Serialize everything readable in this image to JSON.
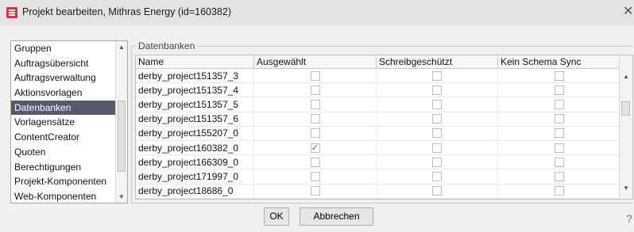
{
  "window": {
    "title": "Projekt bearbeiten, Mithras Energy (id=160382)",
    "close_glyph": "✕"
  },
  "sidebar": {
    "items": [
      {
        "label": "Gruppen"
      },
      {
        "label": "Auftragsübersicht"
      },
      {
        "label": "Auftragsverwaltung"
      },
      {
        "label": "Aktionsvorlagen"
      },
      {
        "label": "Datenbanken",
        "selected": true
      },
      {
        "label": "Vorlagensätze"
      },
      {
        "label": "ContentCreator"
      },
      {
        "label": "Quoten"
      },
      {
        "label": "Berechtigungen"
      },
      {
        "label": "Projekt-Komponenten"
      },
      {
        "label": "Web-Komponenten"
      }
    ]
  },
  "databases": {
    "legend": "Datenbanken",
    "columns": [
      "Name",
      "Ausgewählt",
      "Schreibgeschützt",
      "Kein Schema Sync"
    ],
    "rows": [
      {
        "name": "derby_project151357_3",
        "ausgewaehlt": false,
        "schreibgeschuetzt": false,
        "kein_schema_sync": false
      },
      {
        "name": "derby_project151357_4",
        "ausgewaehlt": false,
        "schreibgeschuetzt": false,
        "kein_schema_sync": false
      },
      {
        "name": "derby_project151357_5",
        "ausgewaehlt": false,
        "schreibgeschuetzt": false,
        "kein_schema_sync": false
      },
      {
        "name": "derby_project151357_6",
        "ausgewaehlt": false,
        "schreibgeschuetzt": false,
        "kein_schema_sync": false
      },
      {
        "name": "derby_project155207_0",
        "ausgewaehlt": false,
        "schreibgeschuetzt": false,
        "kein_schema_sync": false
      },
      {
        "name": "derby_project160382_0",
        "ausgewaehlt": true,
        "schreibgeschuetzt": false,
        "kein_schema_sync": false
      },
      {
        "name": "derby_project166309_0",
        "ausgewaehlt": false,
        "schreibgeschuetzt": false,
        "kein_schema_sync": false
      },
      {
        "name": "derby_project171997_0",
        "ausgewaehlt": false,
        "schreibgeschuetzt": false,
        "kein_schema_sync": false
      },
      {
        "name": "derby_project18686_0",
        "ausgewaehlt": false,
        "schreibgeschuetzt": false,
        "kein_schema_sync": false
      }
    ]
  },
  "buttons": {
    "ok_label": "OK",
    "cancel_label": "Abbrechen"
  },
  "help_glyph": "?",
  "colors": {
    "selection": "#575a6c",
    "app_icon": "#d6334a"
  },
  "icons": {
    "app": "app-logo-icon",
    "close": "close-icon",
    "help": "help-icon",
    "scroll_up": "chevron-up-icon",
    "scroll_down": "chevron-down-icon",
    "check": "check-icon"
  }
}
